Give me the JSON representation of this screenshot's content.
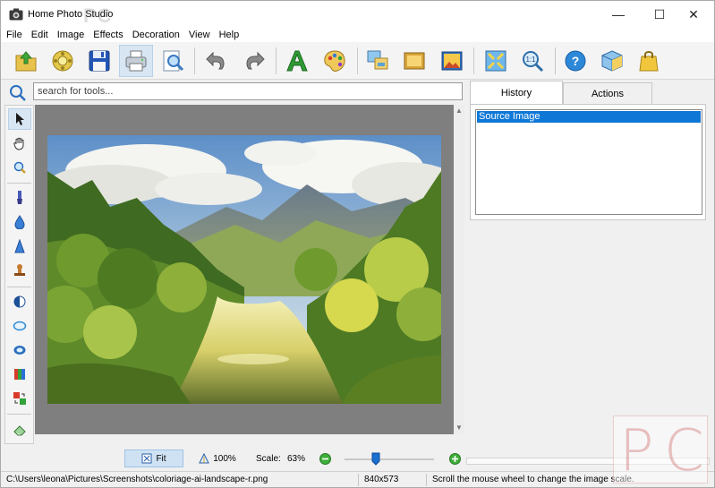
{
  "window": {
    "title": "Home Photo Studio",
    "watermark": "PC",
    "minimize_glyph": "—",
    "maximize_glyph": "☐",
    "close_glyph": "✕"
  },
  "menu": [
    "File",
    "Edit",
    "Image",
    "Effects",
    "Decoration",
    "View",
    "Help"
  ],
  "toolbar": [
    {
      "name": "open-icon"
    },
    {
      "name": "photo-roll-icon"
    },
    {
      "name": "save-icon"
    },
    {
      "name": "print-icon",
      "active": true
    },
    {
      "name": "preview-icon"
    },
    {
      "name": "undo-icon"
    },
    {
      "name": "redo-icon"
    },
    {
      "name": "text-icon"
    },
    {
      "name": "palette-icon"
    },
    {
      "name": "photo-collage-icon"
    },
    {
      "name": "frame-icon"
    },
    {
      "name": "picture-icon"
    },
    {
      "name": "fit-window-icon"
    },
    {
      "name": "actual-size-icon"
    },
    {
      "name": "help-icon"
    },
    {
      "name": "box-icon"
    },
    {
      "name": "shopping-bag-icon"
    }
  ],
  "search": {
    "placeholder": "search for tools..."
  },
  "tools": [
    {
      "name": "pointer-icon",
      "active": true
    },
    {
      "name": "hand-icon"
    },
    {
      "name": "zoom-tool-icon"
    },
    {
      "name": "brush-icon"
    },
    {
      "name": "blur-drop-icon"
    },
    {
      "name": "sharpen-icon"
    },
    {
      "name": "stamp-icon"
    },
    {
      "name": "contrast-icon"
    },
    {
      "name": "ellipse-select-icon"
    },
    {
      "name": "ring-select-icon"
    },
    {
      "name": "color-balance-icon"
    },
    {
      "name": "replace-color-icon"
    },
    {
      "name": "eraser-icon"
    }
  ],
  "panel": {
    "tabs": [
      "History",
      "Actions"
    ],
    "active_tab": "History",
    "history": [
      "Source Image"
    ]
  },
  "zoom": {
    "fit_label": "Fit",
    "actual_label": "100%",
    "scale_label": "Scale:",
    "scale_value": "63%",
    "slider_level": 0.35
  },
  "status": {
    "path": "C:\\Users\\leona\\Pictures\\Screenshots\\coloriage-ai-landscape-r.png",
    "dimensions": "840x573",
    "hint": "Scroll the mouse wheel to change the image scale."
  },
  "colors": {
    "accent": "#0f78d7",
    "canvas_bg": "#7f7f7f",
    "active_button": "#d8e6f3"
  }
}
